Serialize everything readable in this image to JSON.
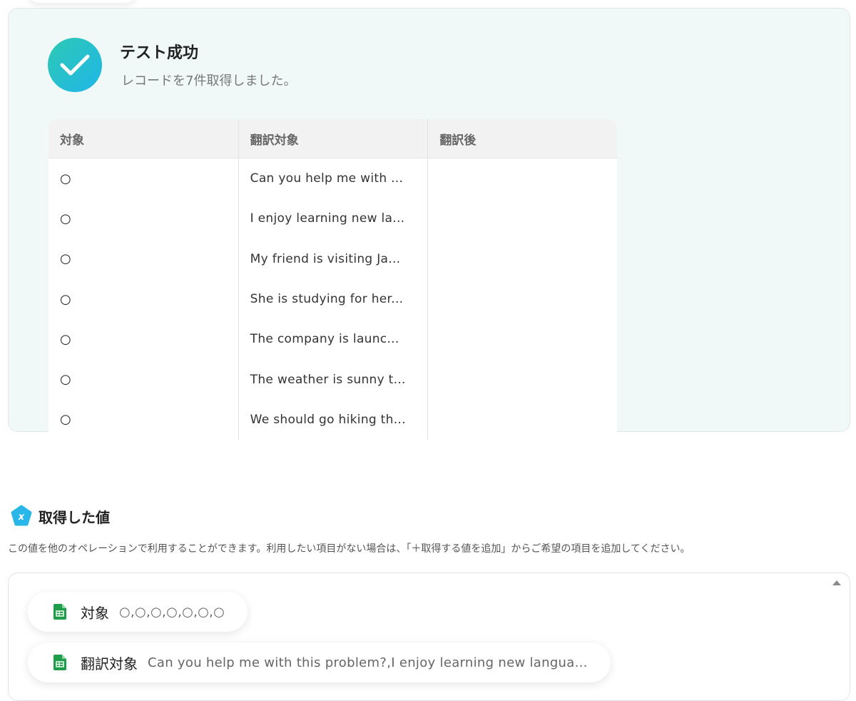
{
  "result": {
    "title": "テスト成功",
    "subtitle": "レコードを7件取得しました。",
    "columns": [
      "対象",
      "翻訳対象",
      "翻訳後"
    ],
    "rows": [
      [
        "○",
        "Can you help me with ...",
        ""
      ],
      [
        "○",
        "I enjoy learning new la...",
        ""
      ],
      [
        "○",
        "My friend is visiting Ja...",
        ""
      ],
      [
        "○",
        "She is studying for her...",
        ""
      ],
      [
        "○",
        "The company is launc...",
        ""
      ],
      [
        "○",
        "The weather is sunny t...",
        ""
      ],
      [
        "○",
        "We should go hiking th...",
        ""
      ]
    ]
  },
  "values": {
    "title": "取得した値",
    "description": "この値を他のオペレーションで利用することができます。利用したい項目がない場合は、「＋取得する値を追加」からご希望の項目を追加してください。",
    "chips": [
      {
        "label": "対象",
        "value": "○,○,○,○,○,○,○"
      },
      {
        "label": "翻訳対象",
        "value": "Can you help me with this problem?,I enjoy learning new langua..."
      }
    ]
  },
  "colors": {
    "panel_bg": "#f0f9f8",
    "accent_gradient_start": "#2ec9b4",
    "accent_gradient_end": "#1fb6e8",
    "sheet_green": "#1e9e4a",
    "badge_blue": "#29b6e8"
  },
  "icons": [
    "check-icon",
    "variable-badge-icon",
    "spreadsheet-icon",
    "scroll-up-icon"
  ]
}
